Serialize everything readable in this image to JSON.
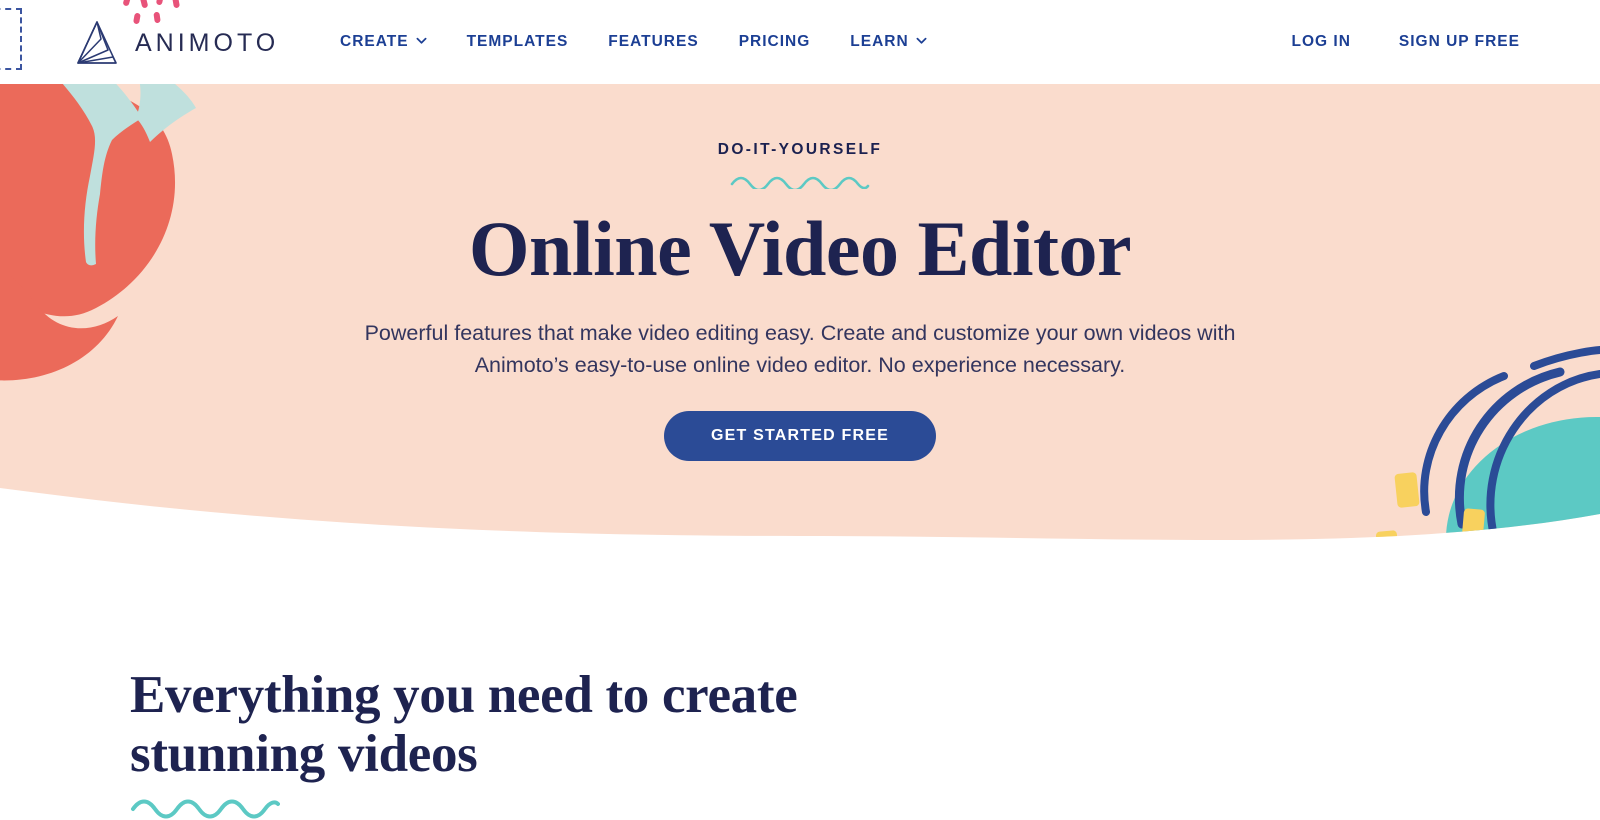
{
  "brand": {
    "name": "ANIMOTO",
    "logo_icon": "animoto-fan-logo"
  },
  "colors": {
    "navy": "#1c3f94",
    "headline_navy": "#1e2350",
    "hero_bg": "#fadccd",
    "coral": "#eb6a5a",
    "teal": "#5cc9c4",
    "mint": "#cfe7e0",
    "yellow": "#f8d15e",
    "pink": "#e8537a",
    "brush_blue": "#2b4b96",
    "cta_bg": "#2b4b96",
    "cta_text": "#ffffff"
  },
  "header": {
    "nav": [
      {
        "label": "CREATE",
        "has_chevron": true,
        "icon": "chevron-down-icon"
      },
      {
        "label": "TEMPLATES",
        "has_chevron": false
      },
      {
        "label": "FEATURES",
        "has_chevron": false
      },
      {
        "label": "PRICING",
        "has_chevron": false
      },
      {
        "label": "LEARN",
        "has_chevron": true,
        "icon": "chevron-down-icon"
      }
    ],
    "auth": [
      {
        "label": "LOG IN"
      },
      {
        "label": "SIGN UP FREE"
      }
    ]
  },
  "hero": {
    "eyebrow": "DO-IT-YOURSELF",
    "headline": "Online Video Editor",
    "subhead": "Powerful features that make video editing easy. Create and customize your own videos with Animoto’s easy-to-use online video editor. No experience necessary.",
    "cta_label": "GET STARTED FREE",
    "decor": {
      "squiggle": "teal-wavy-underline",
      "coral_blob": "coral-blob-shape",
      "teal_brush": "teal-brush-stroke",
      "teal_circle": "teal-circle-shape",
      "blue_spiral": "blue-spiral-brush",
      "yellow_dashes": "yellow-dash-confetti"
    }
  },
  "section2": {
    "title_line1": "Everything you need to create",
    "title_line2": "stunning videos",
    "squiggle": "teal-wavy-underline"
  }
}
